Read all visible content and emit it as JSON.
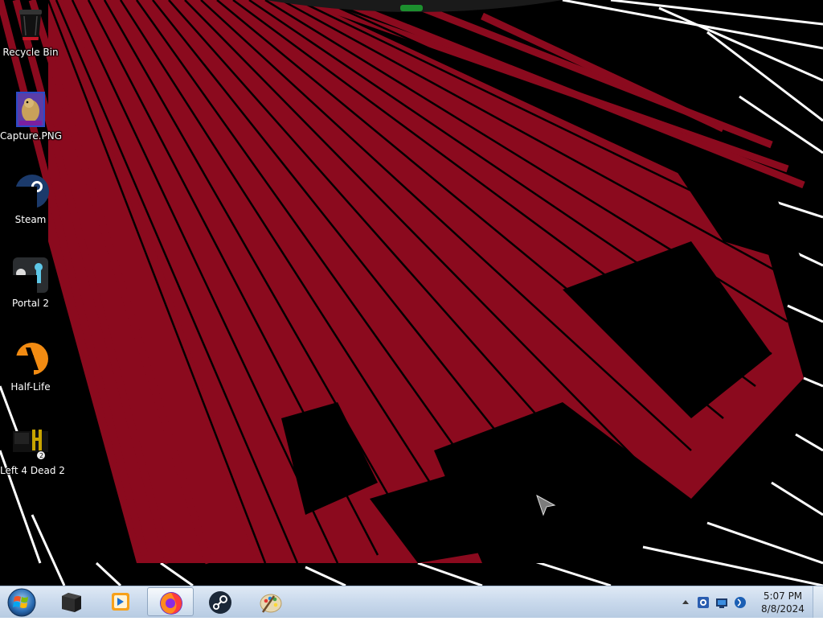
{
  "desktop": {
    "icons": [
      {
        "label": "Recycle Bin",
        "icon": "recycle-bin-icon"
      },
      {
        "label": "Capture.PNG",
        "icon": "image-file-icon"
      },
      {
        "label": "Steam",
        "icon": "steam-icon"
      },
      {
        "label": "Portal 2",
        "icon": "portal-2-icon"
      },
      {
        "label": "Half-Life",
        "icon": "half-life-icon"
      },
      {
        "label": "Left 4 Dead 2",
        "icon": "left-4-dead-2-icon"
      }
    ]
  },
  "taskbar": {
    "start_icon": "windows-start-icon",
    "pinned": [
      {
        "name": "file-explorer",
        "icon": "folder-icon"
      },
      {
        "name": "media-player",
        "icon": "media-player-icon"
      },
      {
        "name": "firefox",
        "icon": "firefox-icon",
        "active": true
      },
      {
        "name": "steam",
        "icon": "steam-icon"
      },
      {
        "name": "paint",
        "icon": "paint-icon"
      }
    ],
    "tray": {
      "icons": [
        "show-hidden-icons-arrow",
        "steam-tray-icon",
        "network-icon",
        "volume-icon"
      ]
    },
    "clock": {
      "time": "5:07 PM",
      "date": "8/8/2024"
    }
  },
  "colors": {
    "wallpaper_red": "#8b0a1e",
    "wallpaper_black": "#000000",
    "taskbar_bg": "#c9d9ec"
  }
}
